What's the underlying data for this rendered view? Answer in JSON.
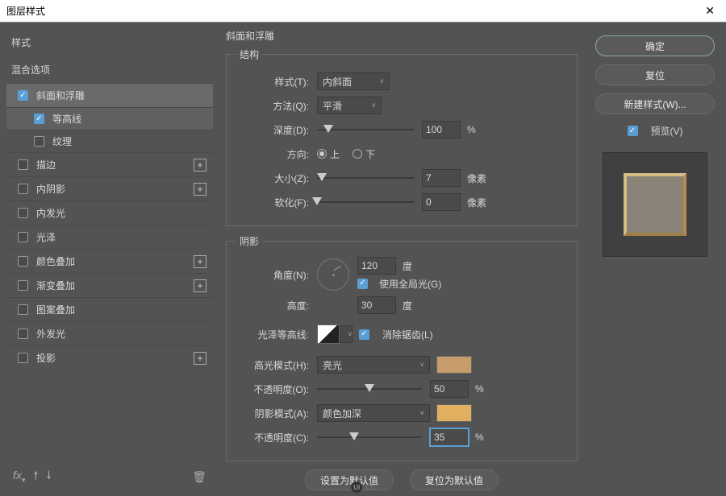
{
  "window": {
    "title": "图层样式"
  },
  "sidebar": {
    "styles_label": "样式",
    "blend_options_label": "混合选项",
    "items": [
      {
        "label": "斜面和浮雕",
        "checked": true,
        "selected": true,
        "add": false
      },
      {
        "label": "等高线",
        "checked": true,
        "sub": true
      },
      {
        "label": "纹理",
        "checked": false,
        "sub": true
      },
      {
        "label": "描边",
        "checked": false,
        "add": true
      },
      {
        "label": "内阴影",
        "checked": false,
        "add": true
      },
      {
        "label": "内发光",
        "checked": false
      },
      {
        "label": "光泽",
        "checked": false
      },
      {
        "label": "颜色叠加",
        "checked": false,
        "add": true
      },
      {
        "label": "渐变叠加",
        "checked": false,
        "add": true
      },
      {
        "label": "图案叠加",
        "checked": false
      },
      {
        "label": "外发光",
        "checked": false
      },
      {
        "label": "投影",
        "checked": false,
        "add": true
      }
    ]
  },
  "panel": {
    "title": "斜面和浮雕",
    "structure": {
      "legend": "结构",
      "style_label": "样式(T):",
      "style_value": "内斜面",
      "technique_label": "方法(Q):",
      "technique_value": "平滑",
      "depth_label": "深度(D):",
      "depth_value": "100",
      "depth_unit": "%",
      "direction_label": "方向:",
      "up_label": "上",
      "down_label": "下",
      "size_label": "大小(Z):",
      "size_value": "7",
      "size_unit": "像素",
      "soften_label": "软化(F):",
      "soften_value": "0",
      "soften_unit": "像素"
    },
    "shading": {
      "legend": "阴影",
      "angle_label": "角度(N):",
      "angle_value": "120",
      "angle_unit": "度",
      "global_light_label": "使用全局光(G)",
      "altitude_label": "高度:",
      "altitude_value": "30",
      "altitude_unit": "度",
      "gloss_contour_label": "光泽等高线:",
      "antialias_label": "消除锯齿(L)",
      "highlight_mode_label": "高光模式(H):",
      "highlight_mode_value": "亮光",
      "highlight_opacity_label": "不透明度(O):",
      "highlight_opacity_value": "50",
      "highlight_opacity_unit": "%",
      "shadow_mode_label": "阴影模式(A):",
      "shadow_mode_value": "颜色加深",
      "shadow_opacity_label": "不透明度(C):",
      "shadow_opacity_value": "35",
      "shadow_opacity_unit": "%"
    },
    "set_default": "设置为默认值",
    "reset_default": "复位为默认值"
  },
  "right": {
    "ok": "确定",
    "cancel": "复位",
    "new_style": "新建样式(W)...",
    "preview": "预览(V)"
  },
  "colors": {
    "highlight": "#c79c6a",
    "shadow": "#e0b060"
  }
}
